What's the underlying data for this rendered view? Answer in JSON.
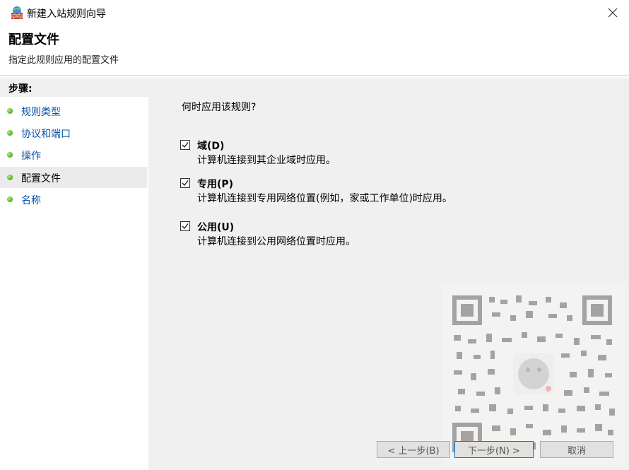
{
  "window": {
    "title": "新建入站规则向导",
    "close_glyph": "✕"
  },
  "header": {
    "title": "配置文件",
    "subtitle": "指定此规则应用的配置文件"
  },
  "sidebar": {
    "title": "步骤:",
    "items": [
      {
        "label": "规则类型",
        "active": false
      },
      {
        "label": "协议和端口",
        "active": false
      },
      {
        "label": "操作",
        "active": false
      },
      {
        "label": "配置文件",
        "active": true
      },
      {
        "label": "名称",
        "active": false
      }
    ]
  },
  "main": {
    "question": "何时应用该规则?",
    "options": [
      {
        "label": "域(D)",
        "description": "计算机连接到其企业域时应用。",
        "checked": true
      },
      {
        "label": "专用(P)",
        "description": "计算机连接到专用网络位置(例如，家或工作单位)时应用。",
        "checked": true
      },
      {
        "label": "公用(U)",
        "description": "计算机连接到公用网络位置时应用。",
        "checked": true
      }
    ]
  },
  "buttons": {
    "back": "< 上一步(B)",
    "next": "下一步(N) >",
    "cancel": "取消"
  },
  "colors": {
    "link": "#0b54a8",
    "panel": "#f0f0f0",
    "bullet": "#5cc02a",
    "focus": "#0078d7"
  },
  "icons": {
    "app": "firewall-wall-icon",
    "close": "close-icon",
    "bullet": "green-dot-icon",
    "check": "checkmark-icon"
  }
}
